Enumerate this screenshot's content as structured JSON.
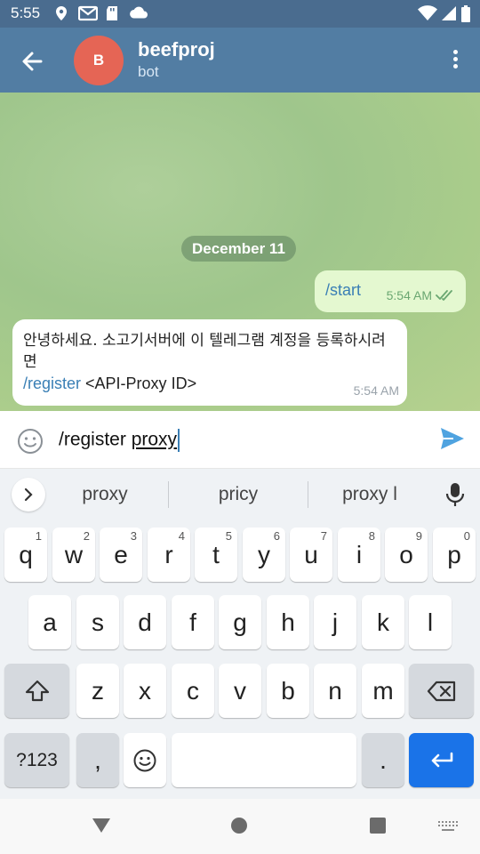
{
  "status": {
    "time": "5:55"
  },
  "header": {
    "avatar_letter": "B",
    "title": "beefproj",
    "subtitle": "bot"
  },
  "chat": {
    "date": "December 11",
    "outgoing": {
      "text": "/start",
      "time": "5:54 AM"
    },
    "incoming": {
      "text": "안녕하세요. 소고기서버에 이 텔레그램 계정을 등록하시려면",
      "command": "/register",
      "rest": " <API-Proxy ID>",
      "time": "5:54 AM"
    }
  },
  "composer": {
    "text_before": "/register ",
    "text_underlined": "proxy"
  },
  "suggestions": [
    "proxy",
    "pricy",
    "proxy l"
  ],
  "keyboard": {
    "row1": [
      {
        "k": "q",
        "h": "1"
      },
      {
        "k": "w",
        "h": "2"
      },
      {
        "k": "e",
        "h": "3"
      },
      {
        "k": "r",
        "h": "4"
      },
      {
        "k": "t",
        "h": "5"
      },
      {
        "k": "y",
        "h": "6"
      },
      {
        "k": "u",
        "h": "7"
      },
      {
        "k": "i",
        "h": "8"
      },
      {
        "k": "o",
        "h": "9"
      },
      {
        "k": "p",
        "h": "0"
      }
    ],
    "row2": [
      "a",
      "s",
      "d",
      "f",
      "g",
      "h",
      "j",
      "k",
      "l"
    ],
    "row3": [
      "z",
      "x",
      "c",
      "v",
      "b",
      "n",
      "m"
    ],
    "symbols": "?123",
    "comma": ",",
    "period": "."
  }
}
